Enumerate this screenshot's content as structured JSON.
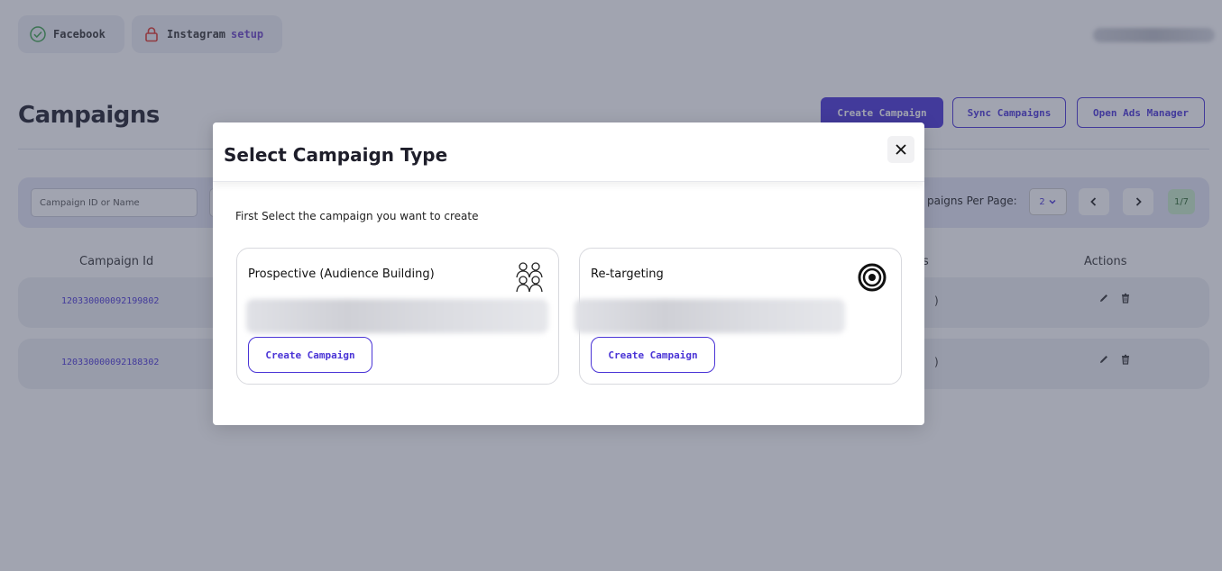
{
  "integrations": {
    "facebook": {
      "label": "Facebook",
      "status": "connected"
    },
    "instagram": {
      "label": "Instagram",
      "action": "setup",
      "status": "locked"
    }
  },
  "page": {
    "title": "Campaigns"
  },
  "header_buttons": {
    "create": "Create Campaign",
    "sync": "Sync Campaigns",
    "open_ads_manager": "Open Ads Manager"
  },
  "filters": {
    "search_placeholder": "Campaign ID or Name",
    "per_page_label": "paigns Per Page:",
    "per_page_value": "2",
    "page_count": "1/7"
  },
  "table": {
    "columns": {
      "id": "Campaign Id",
      "status_partial": "s",
      "actions": "Actions"
    },
    "rows": [
      {
        "id": "120330000092199802",
        "partial": ")"
      },
      {
        "id": "120330000092188302",
        "partial": ")"
      }
    ]
  },
  "modal": {
    "title": "Select Campaign Type",
    "subtitle": "First Select the campaign you want to create",
    "options": [
      {
        "title": "Prospective (Audience Building)",
        "icon": "audience-icon",
        "button": "Create Campaign"
      },
      {
        "title": "Re-targeting",
        "icon": "target-icon",
        "button": "Create Campaign"
      }
    ]
  },
  "colors": {
    "accent": "#4a34d6",
    "setup_link": "#6b43c6",
    "page_badge_bg": "#c8ebc8",
    "overlay": "rgba(58,64,90,0.48)"
  }
}
